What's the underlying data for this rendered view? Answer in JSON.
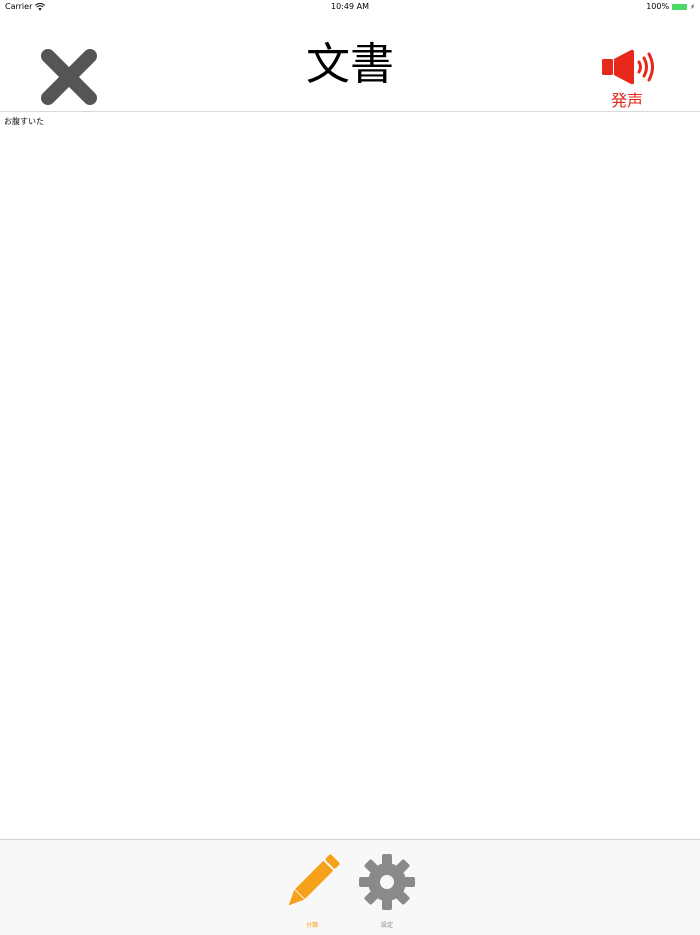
{
  "status_bar": {
    "carrier": "Carrier",
    "time": "10:49 AM",
    "battery": "100%"
  },
  "header": {
    "title": "文書",
    "close_icon": "close-icon",
    "speak_label": "発声",
    "speak_icon": "speaker-icon"
  },
  "content": {
    "text": "お腹すいた"
  },
  "tab_bar": {
    "tabs": [
      {
        "label": "分類",
        "icon": "pencil-icon",
        "selected": true
      },
      {
        "label": "設定",
        "icon": "gear-icon",
        "selected": false
      }
    ]
  },
  "colors": {
    "accent_red": "#e8281b",
    "accent_orange": "#f7a11a",
    "icon_gray": "#555555",
    "inactive_gray": "#8a8a8a",
    "battery_green": "#4cd964"
  }
}
